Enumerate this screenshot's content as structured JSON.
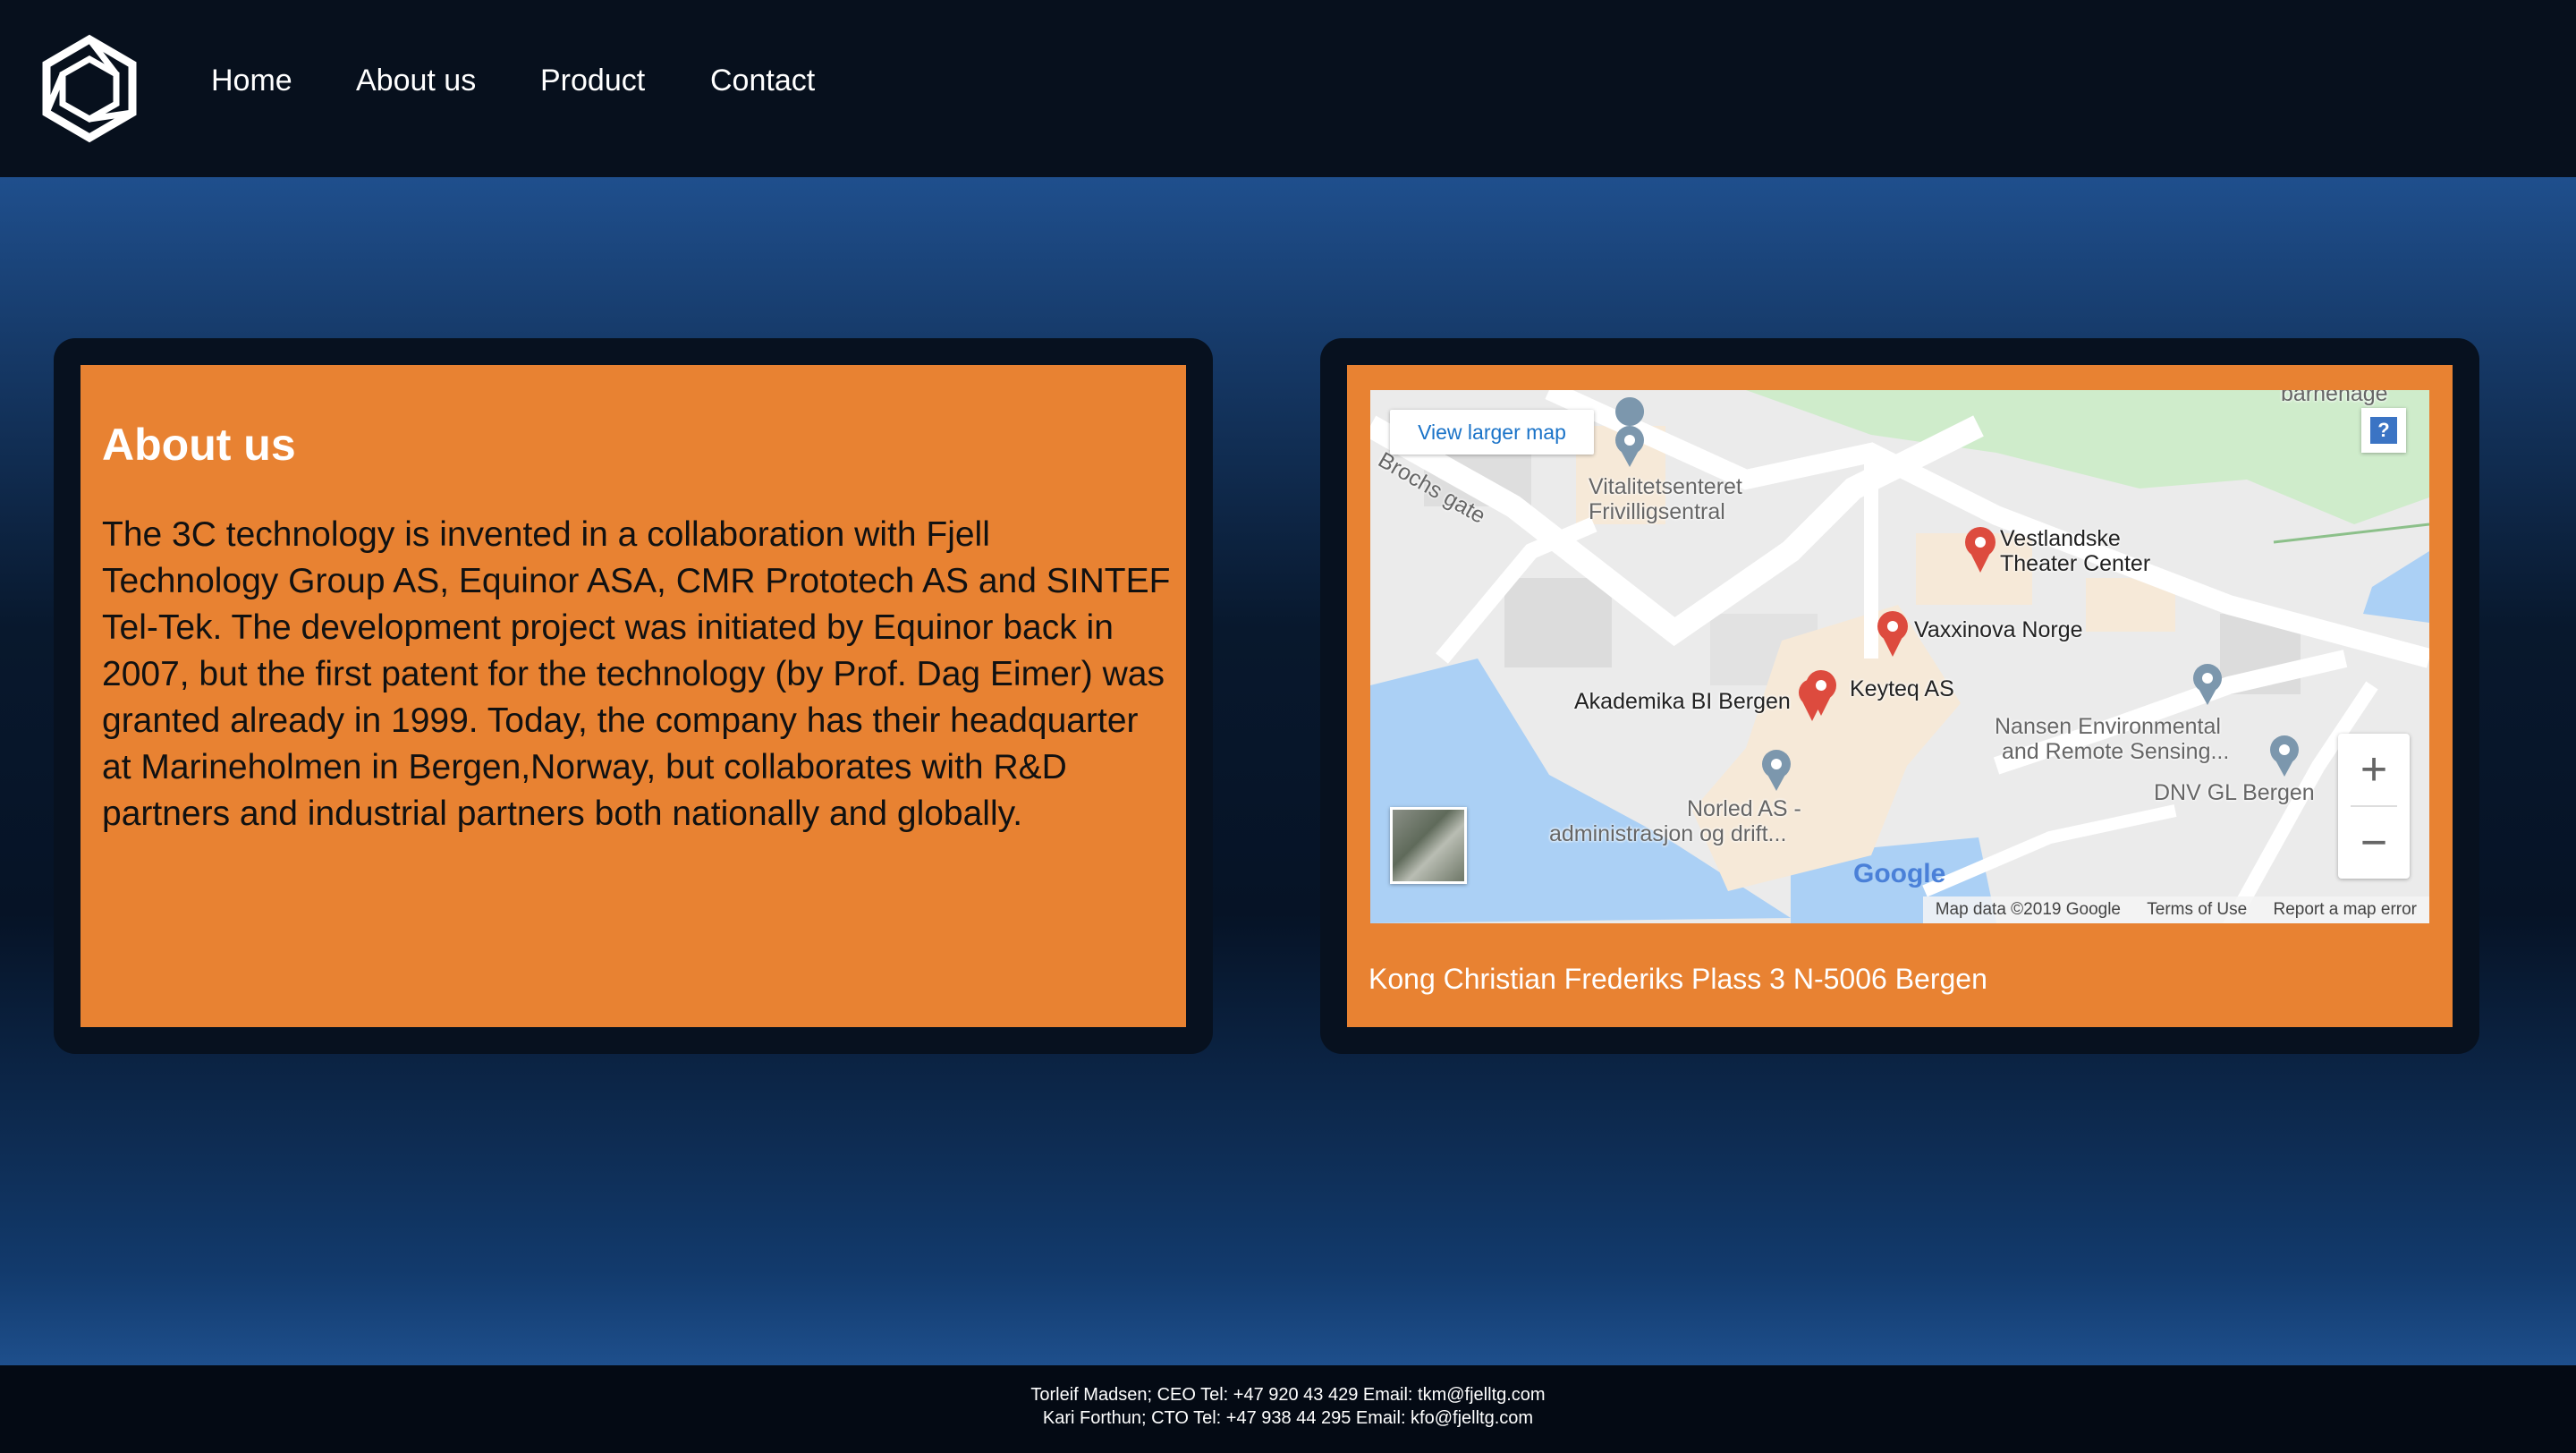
{
  "nav": {
    "logo_icon": "hexagon-logo-icon",
    "links": [
      "Home",
      "About us",
      "Product",
      "Contact"
    ]
  },
  "about": {
    "title": "About us",
    "body": "The 3C technology is invented in a collaboration with Fjell Technology Group AS, Equinor ASA, CMR Prototech AS and SINTEF Tel-Tek. The development project was initiated by Equinor back in 2007, but the first patent for the technology (by Prof. Dag Eimer) was granted already in 1999. Today, the company has their headquarter at Marineholmen in Bergen,Norway, but collaborates with R&D partners and industrial partners both nationally and globally."
  },
  "map": {
    "view_larger": "View larger map",
    "help": "?",
    "zoom_in": "+",
    "zoom_out": "−",
    "street": "Brochs gate",
    "labels": {
      "vitalitet_1": "Vitalitetsenteret",
      "vitalitet_2": "Frivilligsentral",
      "vestlandske_1": "Vestlandske",
      "vestlandske_2": "Theater Center",
      "vaxxinova": "Vaxxinova Norge",
      "akademika": "Akademika BI Bergen",
      "keyteq": "Keyteq AS",
      "nansen_1": "Nansen Environmental",
      "nansen_2": "and Remote Sensing...",
      "dnv": "DNV GL Bergen",
      "norled_1": "Norled AS -",
      "norled_2": "administrasjon og drift...",
      "barnehage": "barnehage"
    },
    "google": "Google",
    "attribution": {
      "data": "Map data ©2019 Google",
      "terms": "Terms of Use",
      "report": "Report a map error"
    }
  },
  "address": "Kong Christian Frederiks Plass 3 N-5006 Bergen",
  "footer": {
    "line1": "Torleif Madsen; CEO Tel: +47 920 43 429 Email: tkm@fjelltg.com",
    "line2": "Kari Forthun; CTO Tel: +47 938 44 295 Email: kfo@fjelltg.com"
  }
}
